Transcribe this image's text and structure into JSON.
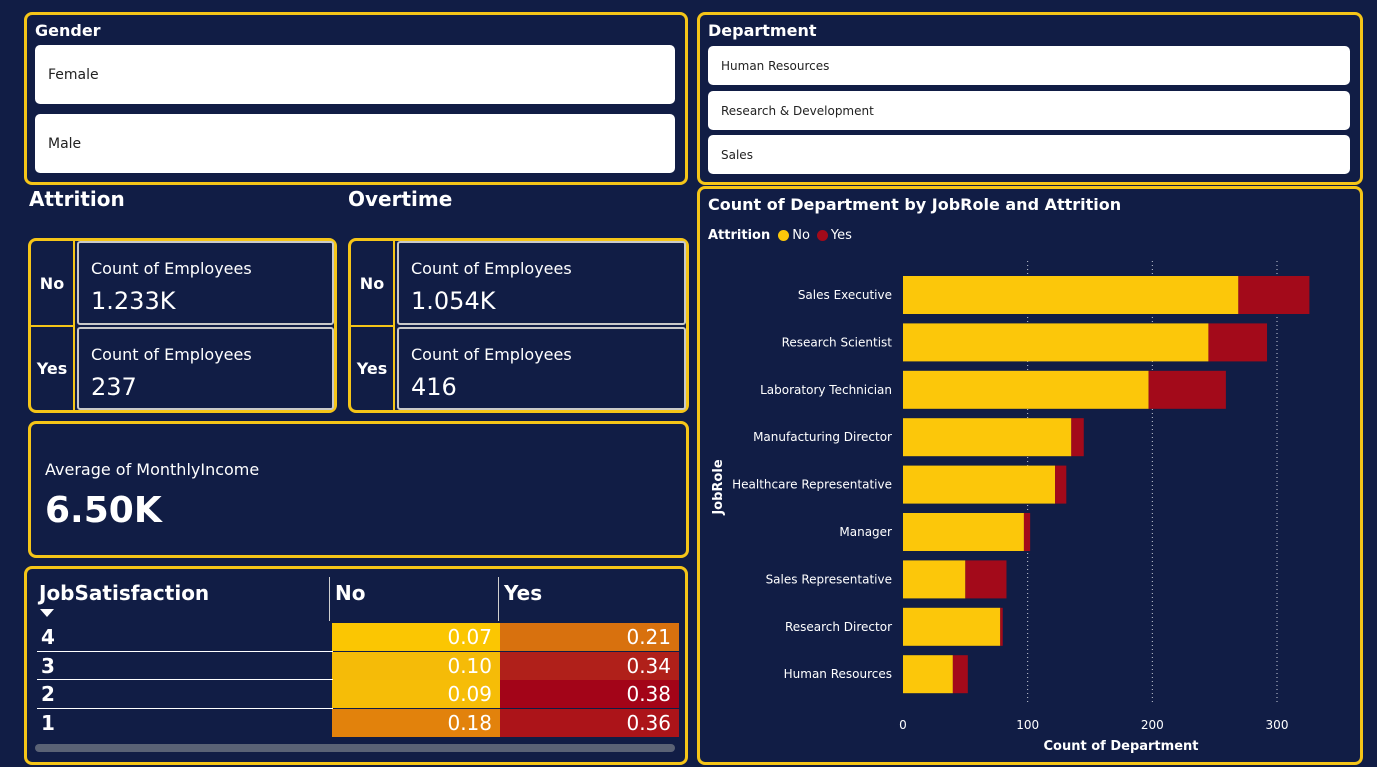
{
  "gender": {
    "title": "Gender",
    "items": [
      "Female",
      "Male"
    ]
  },
  "department": {
    "title": "Department",
    "items": [
      "Human Resources",
      "Research & Development",
      "Sales"
    ]
  },
  "attrition": {
    "title": "Attrition",
    "rows": [
      {
        "label": "No",
        "metric": "Count of Employees",
        "value": "1.233K"
      },
      {
        "label": "Yes",
        "metric": "Count of Employees",
        "value": "237"
      }
    ]
  },
  "overtime": {
    "title": "Overtime",
    "rows": [
      {
        "label": "No",
        "metric": "Count of Employees",
        "value": "1.054K"
      },
      {
        "label": "Yes",
        "metric": "Count of Employees",
        "value": "416"
      }
    ]
  },
  "income": {
    "label": "Average of MonthlyIncome",
    "value": "6.50K"
  },
  "matrix": {
    "row_header": "JobSatisfaction",
    "col_headers": [
      "No",
      "Yes"
    ],
    "rows": [
      {
        "label": "4",
        "no": "0.07",
        "yes": "0.21"
      },
      {
        "label": "3",
        "no": "0.10",
        "yes": "0.34"
      },
      {
        "label": "2",
        "no": "0.09",
        "yes": "0.38"
      },
      {
        "label": "1",
        "no": "0.18",
        "yes": "0.36"
      }
    ],
    "colors": {
      "no": [
        "#fbc602",
        "#f5bb08",
        "#f6bd07",
        "#e2820c"
      ],
      "yes": [
        "#d8710e",
        "#b0201a",
        "#a30418",
        "#ac1419"
      ]
    }
  },
  "chart_data": {
    "type": "bar",
    "orientation": "horizontal",
    "stacked": true,
    "title": "Count of Department by JobRole and Attrition",
    "legend_title": "Attrition",
    "legend_position": "top-left",
    "xlabel": "Count of Department",
    "ylabel": "JobRole",
    "xlim": [
      0,
      330
    ],
    "xticks": [
      0,
      100,
      200,
      300
    ],
    "grid": true,
    "categories": [
      "Sales Executive",
      "Research Scientist",
      "Laboratory Technician",
      "Manufacturing Director",
      "Healthcare Representative",
      "Manager",
      "Sales Representative",
      "Research Director",
      "Human Resources"
    ],
    "series": [
      {
        "name": "No",
        "color": "#fcc70a",
        "values": [
          269,
          245,
          197,
          135,
          122,
          97,
          50,
          78,
          40
        ]
      },
      {
        "name": "Yes",
        "color": "#a30a1a",
        "values": [
          57,
          47,
          62,
          10,
          9,
          5,
          33,
          2,
          12
        ]
      }
    ]
  }
}
